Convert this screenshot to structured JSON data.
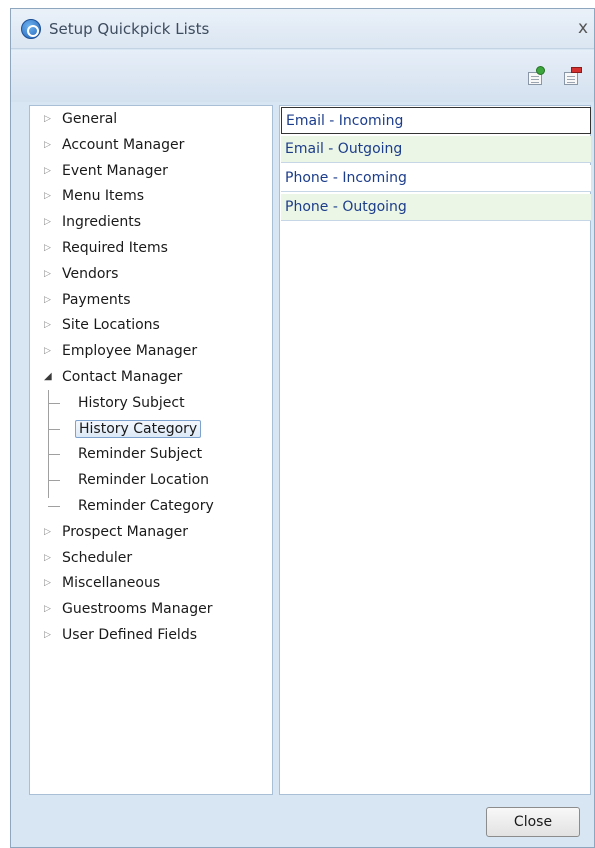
{
  "window": {
    "title": "Setup Quickpick Lists",
    "close_glyph": "x"
  },
  "toolbar": {
    "add_icon": "add-list-icon",
    "remove_icon": "remove-list-icon"
  },
  "tree": {
    "items": [
      {
        "label": "General",
        "expanded": false
      },
      {
        "label": "Account Manager",
        "expanded": false
      },
      {
        "label": "Event Manager",
        "expanded": false
      },
      {
        "label": "Menu Items",
        "expanded": false
      },
      {
        "label": "Ingredients",
        "expanded": false
      },
      {
        "label": "Required Items",
        "expanded": false
      },
      {
        "label": "Vendors",
        "expanded": false
      },
      {
        "label": "Payments",
        "expanded": false
      },
      {
        "label": "Site Locations",
        "expanded": false
      },
      {
        "label": "Employee Manager",
        "expanded": false
      },
      {
        "label": "Contact Manager",
        "expanded": true
      },
      {
        "label": "Prospect Manager",
        "expanded": false
      },
      {
        "label": "Scheduler",
        "expanded": false
      },
      {
        "label": "Miscellaneous",
        "expanded": false
      },
      {
        "label": "Guestrooms Manager",
        "expanded": false
      },
      {
        "label": "User Defined Fields",
        "expanded": false
      }
    ],
    "contact_children": [
      {
        "label": "History Subject",
        "selected": false
      },
      {
        "label": "History Category",
        "selected": true
      },
      {
        "label": "Reminder Subject",
        "selected": false
      },
      {
        "label": "Reminder Location",
        "selected": false
      },
      {
        "label": "Reminder Category",
        "selected": false
      }
    ]
  },
  "list": {
    "rows": [
      "Email - Incoming",
      "Email - Outgoing",
      "Phone - Incoming",
      "Phone - Outgoing"
    ]
  },
  "buttons": {
    "close_label": "Close"
  },
  "colors": {
    "accent": "#1c3d8a",
    "alt_row": "#ecf6e6",
    "window_bg": "#d8e5f2"
  }
}
